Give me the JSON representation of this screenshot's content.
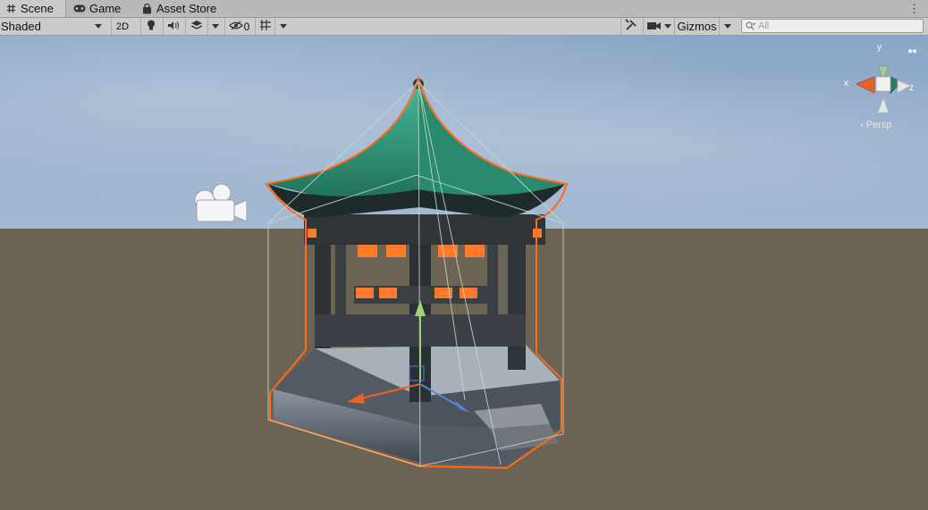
{
  "tabs": [
    {
      "label": "Scene",
      "icon": "grid-icon",
      "active": true
    },
    {
      "label": "Game",
      "icon": "gamepad-icon",
      "active": false
    },
    {
      "label": "Asset Store",
      "icon": "shopping-bag-icon",
      "active": false
    }
  ],
  "toolbar": {
    "shading_mode": "Shaded",
    "toggle_2d": "2D",
    "hidden_count": "0",
    "gizmos_label": "Gizmos",
    "search_placeholder": "All"
  },
  "scene_gizmo": {
    "y_label": "y",
    "x_label": "x",
    "z_label": "z",
    "projection_label": "‹ Persp"
  },
  "colors": {
    "selection_outline": "#ff6a1a",
    "roof": "#2f9c80",
    "y_axis": "#a0d07a",
    "x_axis": "#e8622c",
    "z_axis": "#5a86d4"
  }
}
